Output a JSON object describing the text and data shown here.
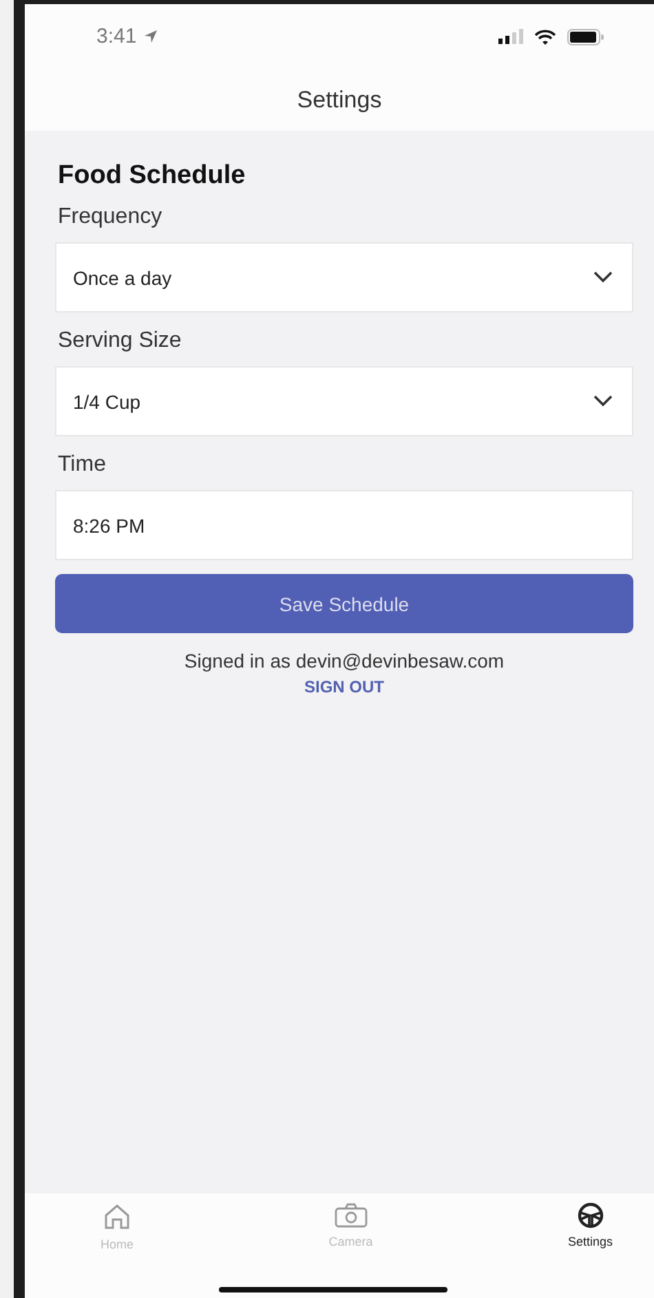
{
  "status_bar": {
    "time": "3:41"
  },
  "header": {
    "title": "Settings"
  },
  "section": {
    "title": "Food Schedule"
  },
  "fields": [
    {
      "label": "Frequency",
      "kind": "dropdown",
      "value": "Once a day"
    },
    {
      "label": "Serving Size",
      "kind": "dropdown",
      "value": "1/4 Cup"
    },
    {
      "label": "Time",
      "kind": "text",
      "value": "8:26 PM"
    }
  ],
  "save_button": {
    "label": "Save Schedule"
  },
  "account": {
    "signed_in_text": "Signed in as devin@devinbesaw.com",
    "sign_out": "SIGN OUT"
  },
  "tabs": [
    {
      "label": "Home",
      "kind": "home",
      "selected": false
    },
    {
      "label": "Camera",
      "kind": "camera",
      "selected": false
    },
    {
      "label": "Settings",
      "kind": "settings",
      "selected": true
    }
  ]
}
